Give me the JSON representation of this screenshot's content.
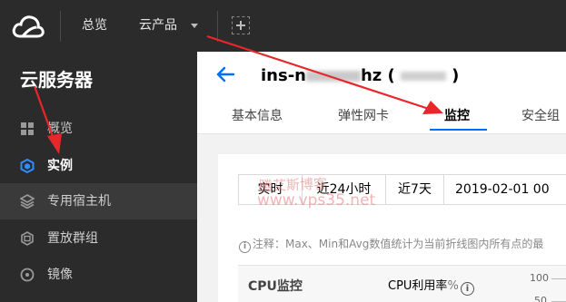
{
  "topbar": {
    "nav_overview": "总览",
    "nav_products": "云产品"
  },
  "sidebar": {
    "title": "云服务器",
    "items": [
      {
        "label": "概览",
        "icon": "grid-icon"
      },
      {
        "label": "实例",
        "icon": "cube-icon"
      },
      {
        "label": "专用宿主机",
        "icon": "layers-icon"
      },
      {
        "label": "置放群组",
        "icon": "placement-group-icon"
      },
      {
        "label": "镜像",
        "icon": "disc-icon"
      }
    ],
    "selected_index": 1
  },
  "instance": {
    "title_prefix": "ins-n",
    "title_mid": "hz (",
    "title_suffix": ")"
  },
  "tabs": [
    "基本信息",
    "弹性网卡",
    "监控",
    "安全组"
  ],
  "active_tab_index": 2,
  "time_ranges": [
    "实时",
    "近24小时",
    "近7天",
    "2019-02-01 00"
  ],
  "watermark": {
    "line1": "腾艾斯博客",
    "line2": "www.vps35.net"
  },
  "note": "注释：Max、Min和Avg数值统计为当前折线图内所有点的最",
  "monitor": {
    "section_title": "CPU监控",
    "metric_label": "CPU利用率",
    "metric_unit": "%",
    "info_glyph": "i",
    "axis": {
      "top": "100",
      "mid": "50"
    }
  },
  "colors": {
    "topbar_bg": "#2b2b2b",
    "accent_blue": "#006eff",
    "arrow_red": "#e8262b"
  }
}
